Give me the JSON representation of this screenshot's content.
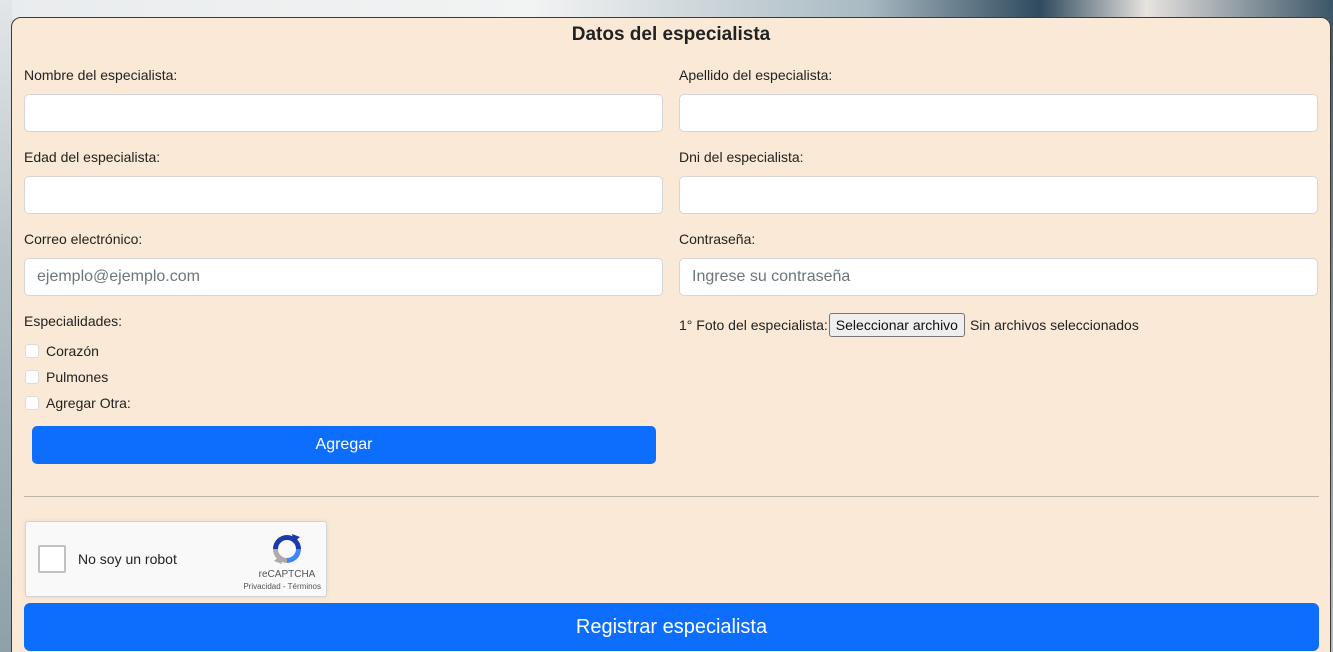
{
  "form": {
    "title": "Datos del especialista",
    "nombre_label": "Nombre del especialista:",
    "apellido_label": "Apellido del especialista:",
    "edad_label": "Edad del especialista:",
    "dni_label": "Dni del especialista:",
    "correo_label": "Correo electrónico:",
    "correo_placeholder": "ejemplo@ejemplo.com",
    "contrasena_label": "Contraseña:",
    "contrasena_placeholder": "Ingrese su contraseña",
    "especialidades_label": "Especialidades:",
    "especialidades": [
      {
        "label": "Corazón",
        "checked": false
      },
      {
        "label": "Pulmones",
        "checked": false
      },
      {
        "label": "Agregar Otra:",
        "checked": false
      }
    ],
    "agregar_button": "Agregar",
    "foto_label": "1° Foto del especialista:",
    "file_button": "Seleccionar archivo",
    "file_status": "Sin archivos seleccionados",
    "submit_button": "Registrar especialista"
  },
  "captcha": {
    "text": "No soy un robot",
    "brand": "reCAPTCHA",
    "links": "Privacidad - Términos"
  },
  "colors": {
    "card_background": "#fae9d6",
    "primary": "#0d6efd"
  }
}
